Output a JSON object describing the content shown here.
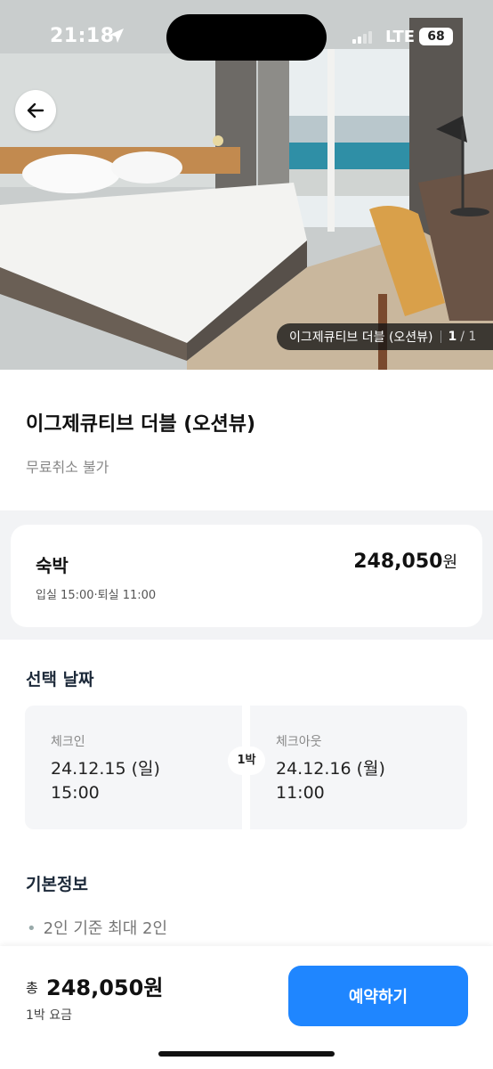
{
  "status_bar": {
    "time": "21:18",
    "network": "LTE",
    "battery": "68"
  },
  "gallery": {
    "caption": "이그제큐티브 더블 (오션뷰)",
    "current": "1",
    "total": "/ 1"
  },
  "room": {
    "title": "이그제큐티브 더블 (오션뷰)",
    "cancel_policy": "무료취소 불가"
  },
  "stay": {
    "label": "숙박",
    "times": "입실 15:00·퇴실 11:00",
    "price": "248,050",
    "currency": "원"
  },
  "dates": {
    "section_title": "선택 날짜",
    "checkin_label": "체크인",
    "checkin_date": "24.12.15 (일)",
    "checkin_time": "15:00",
    "nights": "1박",
    "checkout_label": "체크아웃",
    "checkout_date": "24.12.16 (월)",
    "checkout_time": "11:00"
  },
  "basic_info": {
    "section_title": "기본정보",
    "items": [
      "2인 기준 최대 2인"
    ]
  },
  "footer": {
    "total_prefix": "총",
    "total_price": "248,050원",
    "sub": "1박 요금",
    "book_label": "예약하기"
  },
  "colors": {
    "accent": "#1f86ff",
    "section_bg": "#f2f3f5"
  }
}
